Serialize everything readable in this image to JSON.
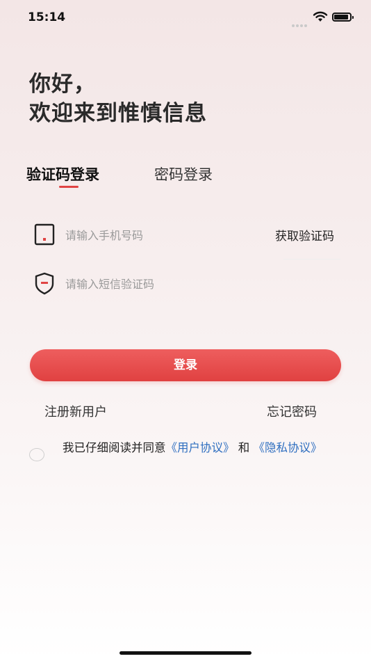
{
  "status_bar": {
    "time": "15:14"
  },
  "greeting": {
    "line1": "你好，",
    "line2": "欢迎来到惟慎信息"
  },
  "tabs": [
    {
      "label": "验证码登录",
      "active": true
    },
    {
      "label": "密码登录",
      "active": false
    }
  ],
  "form": {
    "phone_placeholder": "请输入手机号码",
    "phone_value": "",
    "get_code_label": "获取验证码",
    "code_placeholder": "请输入短信验证码",
    "code_value": ""
  },
  "login_button_label": "登录",
  "links": {
    "register": "注册新用户",
    "forgot": "忘记密码"
  },
  "agreement": {
    "prefix": "我已仔细阅读并同意",
    "user_agreement": "《用户协议》",
    "connector": "和",
    "privacy_policy": "《隐私协议》",
    "checked": false
  },
  "colors": {
    "accent": "#e04444",
    "link": "#2f6fc0"
  }
}
